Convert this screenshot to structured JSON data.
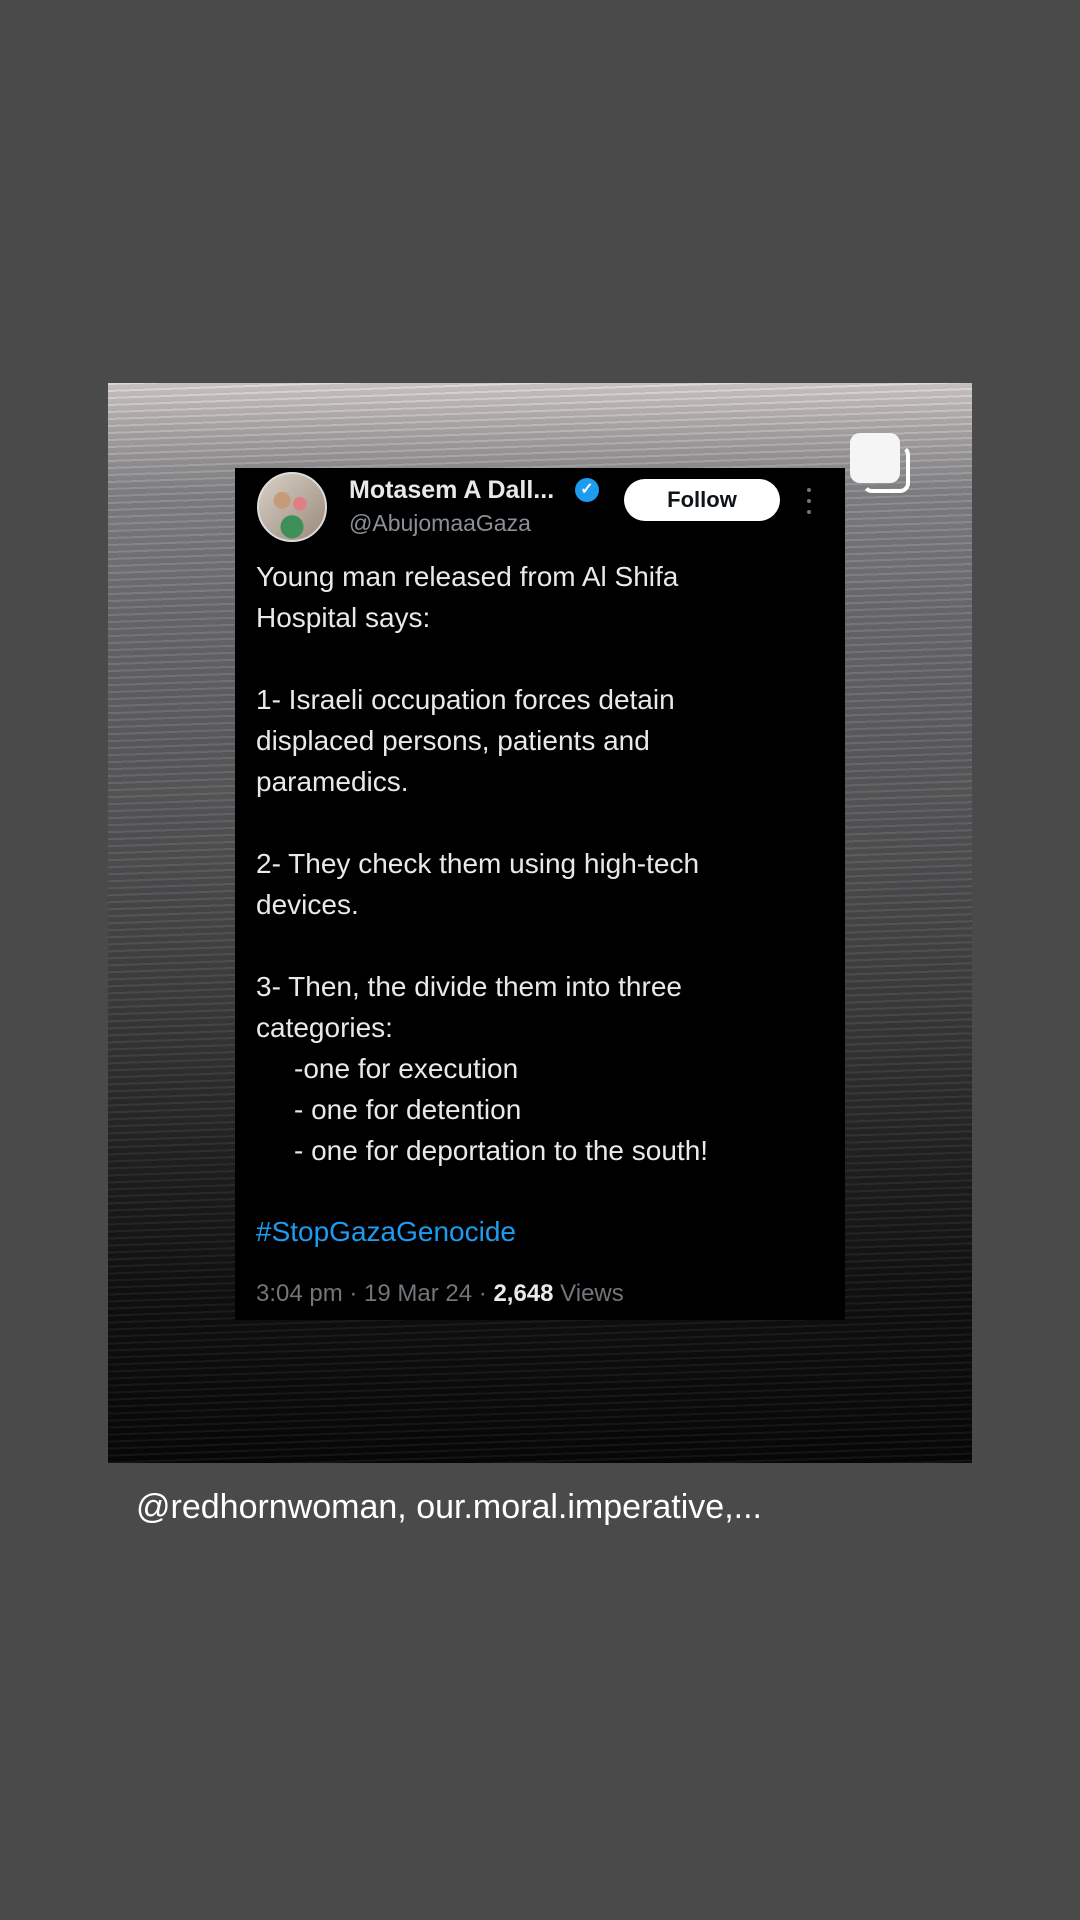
{
  "tweet": {
    "author_name": "Motasem A Dall...",
    "verified_icon": "verified-badge-icon",
    "handle": "@AbujomaaGaza",
    "follow_label": "Follow",
    "lines": [
      "Young man released from Al Shifa",
      "Hospital says:",
      "1- Israeli occupation forces detain",
      "displaced persons, patients and",
      "paramedics.",
      "2- They check them using high-tech",
      "devices.",
      "3- Then, the divide them into three",
      "categories:",
      "-one for execution",
      "- one for detention",
      "- one for deportation to the south!"
    ],
    "hashtag": "#StopGazaGenocide",
    "time": "3:04 pm",
    "date": "19 Mar 24",
    "views_count": "2,648",
    "views_label": "Views",
    "separator": " · "
  },
  "caption": "@redhornwoman, our.moral.imperative,...",
  "colors": {
    "background": "#4a4a4a",
    "tweet_bg": "#000000",
    "hashtag": "#1d9bf0",
    "verified": "#1d9bf0",
    "muted": "#71767b"
  }
}
